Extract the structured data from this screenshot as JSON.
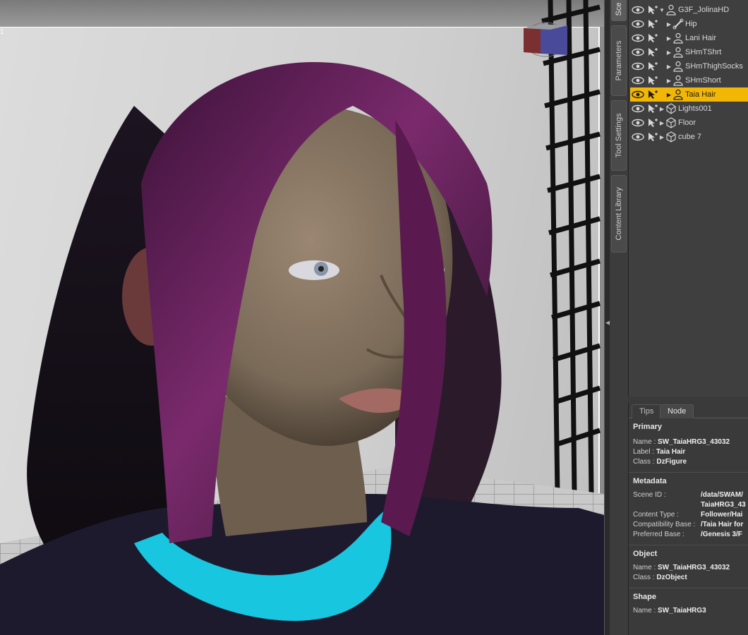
{
  "viewport": {
    "corner_label": "1"
  },
  "side_tabs": [
    {
      "label": "Sce"
    },
    {
      "label": "Parameters"
    },
    {
      "label": "Tool Settings"
    },
    {
      "label": "Content Library"
    }
  ],
  "scene": {
    "items": [
      {
        "label": "G3F_JolinaHD",
        "level": 0,
        "expanded": true,
        "selected": false,
        "icon": "figure-icon"
      },
      {
        "label": "Hip",
        "level": 1,
        "expanded": false,
        "selected": false,
        "icon": "bone-icon"
      },
      {
        "label": "Lani Hair",
        "level": 1,
        "expanded": false,
        "selected": false,
        "icon": "figure-icon"
      },
      {
        "label": "SHmTShrt",
        "level": 1,
        "expanded": false,
        "selected": false,
        "icon": "figure-icon"
      },
      {
        "label": "SHmThighSocks",
        "level": 1,
        "expanded": false,
        "selected": false,
        "icon": "figure-icon"
      },
      {
        "label": "SHmShort",
        "level": 1,
        "expanded": false,
        "selected": false,
        "icon": "figure-icon"
      },
      {
        "label": "Taia Hair",
        "level": 1,
        "expanded": false,
        "selected": true,
        "icon": "figure-icon"
      },
      {
        "label": "Lights001",
        "level": 0,
        "expanded": false,
        "selected": false,
        "icon": "group-icon"
      },
      {
        "label": "Floor",
        "level": 0,
        "expanded": false,
        "selected": false,
        "icon": "cube-icon"
      },
      {
        "label": "cube 7",
        "level": 0,
        "expanded": false,
        "selected": false,
        "icon": "cube-icon"
      }
    ]
  },
  "info": {
    "tabs": [
      "Tips",
      "Node"
    ],
    "active_tab": "Node",
    "primary": {
      "title": "Primary",
      "name_key": "Name :",
      "name_val": "SW_TaiaHRG3_43032",
      "label_key": "Label :",
      "label_val": "Taia Hair",
      "class_key": "Class :",
      "class_val": "DzFigure"
    },
    "metadata": {
      "title": "Metadata",
      "scene_id_key": "Scene ID :",
      "scene_id_val1": "/data/SWAM/",
      "scene_id_val2": "TaiaHRG3_43",
      "content_type_key": "Content Type :",
      "content_type_val": "Follower/Hai",
      "compat_key": "Compatibility Base :",
      "compat_val": "/Taia Hair for",
      "preferred_key": "Preferred Base :",
      "preferred_val": "/Genesis 3/F"
    },
    "object": {
      "title": "Object",
      "name_key": "Name :",
      "name_val": "SW_TaiaHRG3_43032",
      "class_key": "Class :",
      "class_val": "DzObject"
    },
    "shape": {
      "title": "Shape",
      "name_key": "Name :",
      "name_val": "SW_TaiaHRG3"
    }
  },
  "colors": {
    "selection": "#f2b705",
    "hair": "#6a1f5a",
    "collar": "#19c6e0",
    "sweater": "#1e1a2e",
    "skin": "#8c7a66"
  }
}
